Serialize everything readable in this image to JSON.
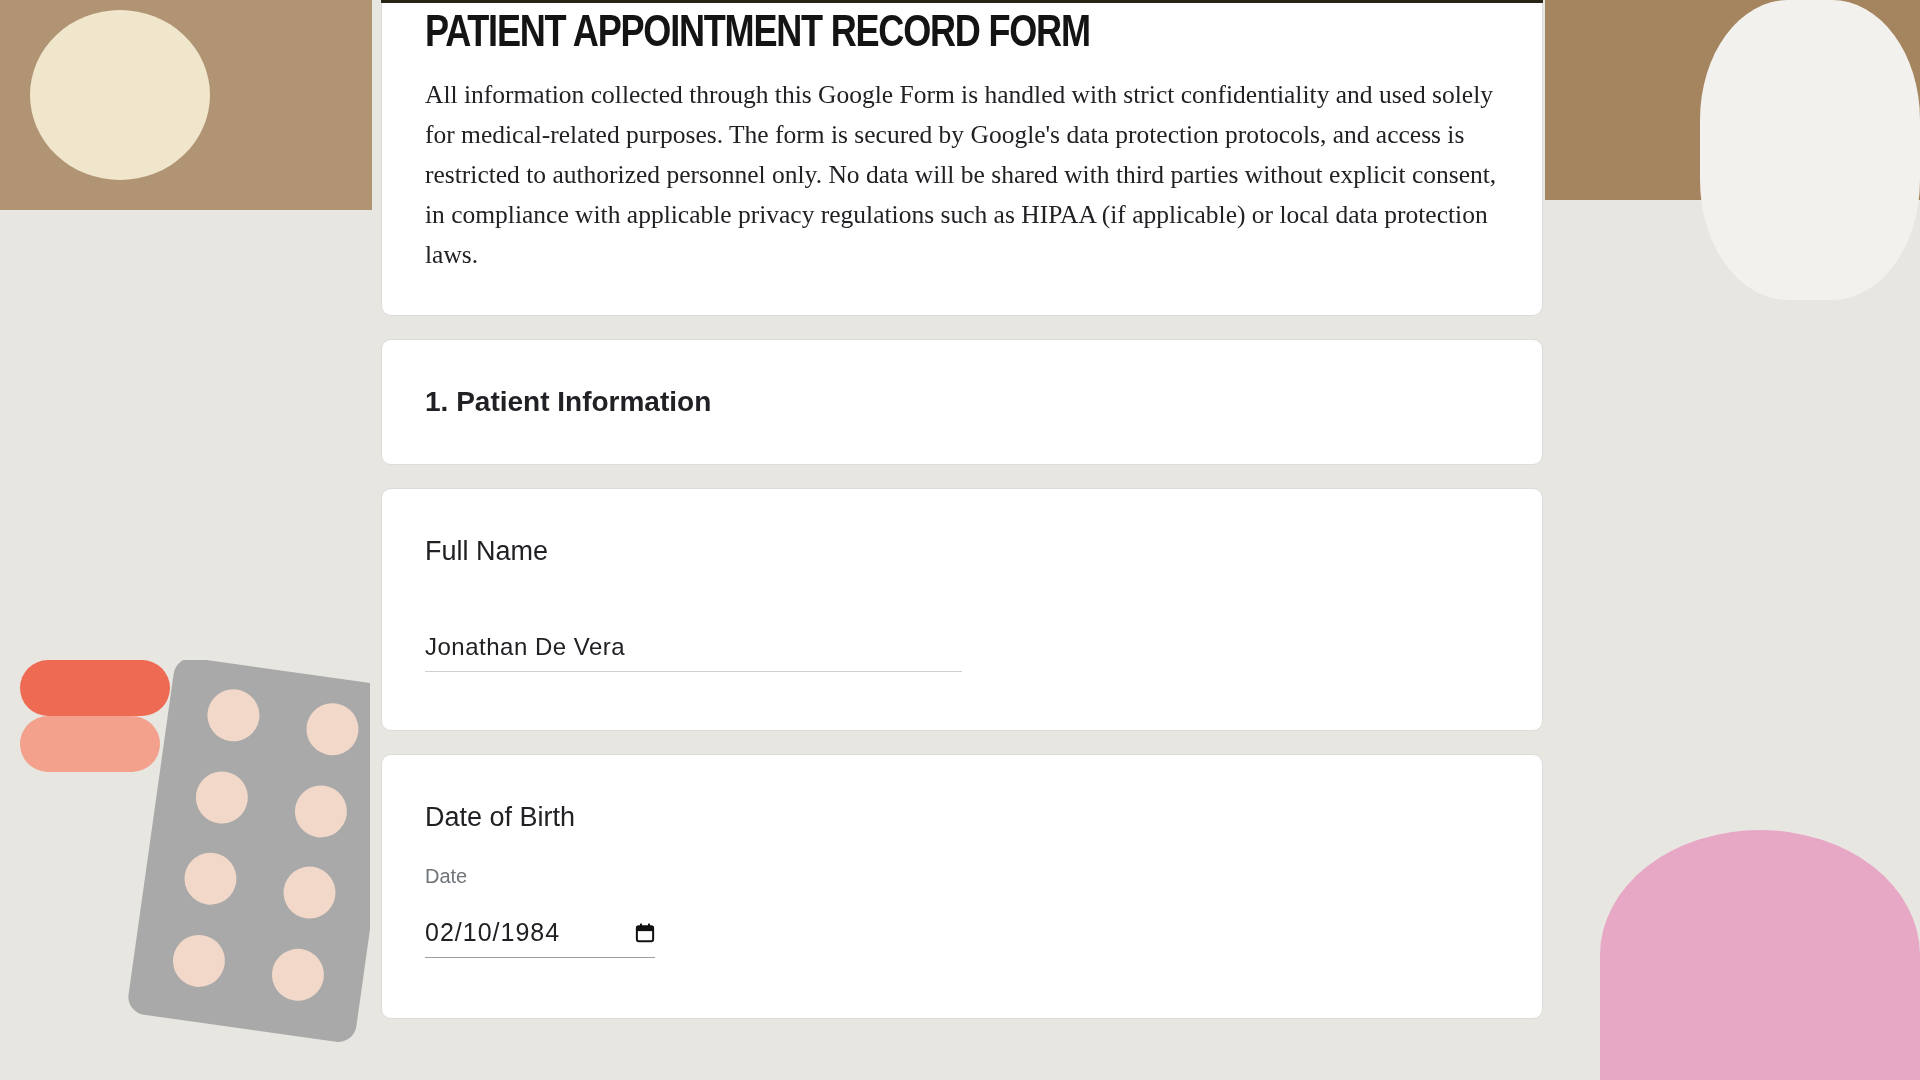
{
  "form": {
    "title": "PATIENT APPOINTMENT RECORD FORM",
    "description": "All information collected through this Google Form is handled with strict confidentiality and used solely for medical-related purposes. The form is secured by Google's data protection protocols, and access is restricted to authorized personnel only. No data will be shared with third parties without explicit consent, in compliance with applicable privacy regulations such as HIPAA (if applicable) or local data protection laws."
  },
  "items": [
    {
      "kind": "section",
      "title": "1. Patient Information"
    },
    {
      "kind": "text",
      "label": "Full Name",
      "value": "Jonathan De Vera"
    },
    {
      "kind": "date",
      "label": "Date of Birth",
      "sublabel": "Date",
      "value": "02/10/1984"
    }
  ]
}
